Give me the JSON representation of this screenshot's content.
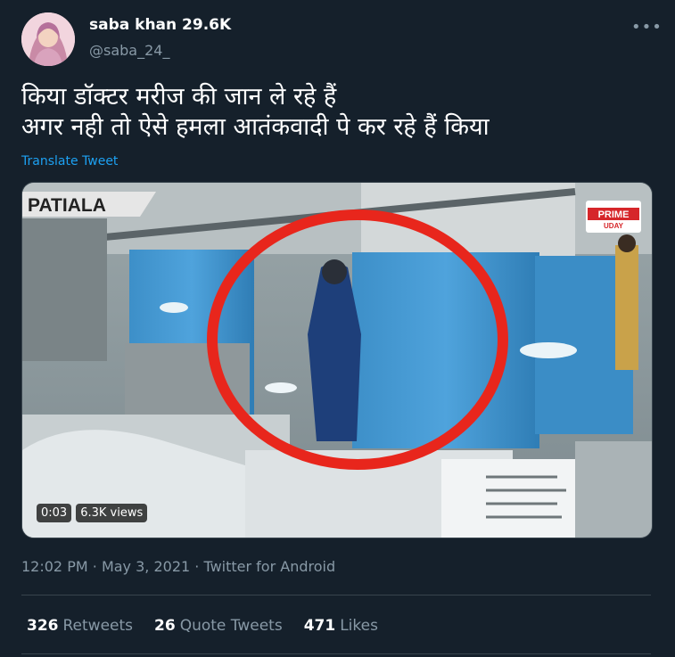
{
  "author": {
    "display_name": "saba khan 29.6K",
    "handle": "@saba_24_"
  },
  "more_label": "•••",
  "tweet": {
    "line1": "किया डॉक्टर मरीज की जान ले रहे हैं",
    "line2": "अगर नही तो ऐसे हमला आतंकवादी पे कर रहे हैं किया",
    "translate_label": "Translate Tweet"
  },
  "media": {
    "type": "video",
    "overlay_location": "PATIALA",
    "channel_logo_line1": "PRIME",
    "channel_logo_line2": "UDAY",
    "duration": "0:03",
    "views": "6.3K views"
  },
  "meta": {
    "time": "12:02 PM",
    "separator": "·",
    "date": "May 3, 2021",
    "source": "Twitter for Android"
  },
  "stats": {
    "retweets_count": "326",
    "retweets_label": "Retweets",
    "quote_count": "26",
    "quote_label": "Quote Tweets",
    "likes_count": "471",
    "likes_label": "Likes"
  },
  "colors": {
    "background": "#15202b",
    "secondary_text": "#8899a6",
    "link": "#1da1f2",
    "divider": "#38444d",
    "highlight_circle": "#e8261c"
  }
}
